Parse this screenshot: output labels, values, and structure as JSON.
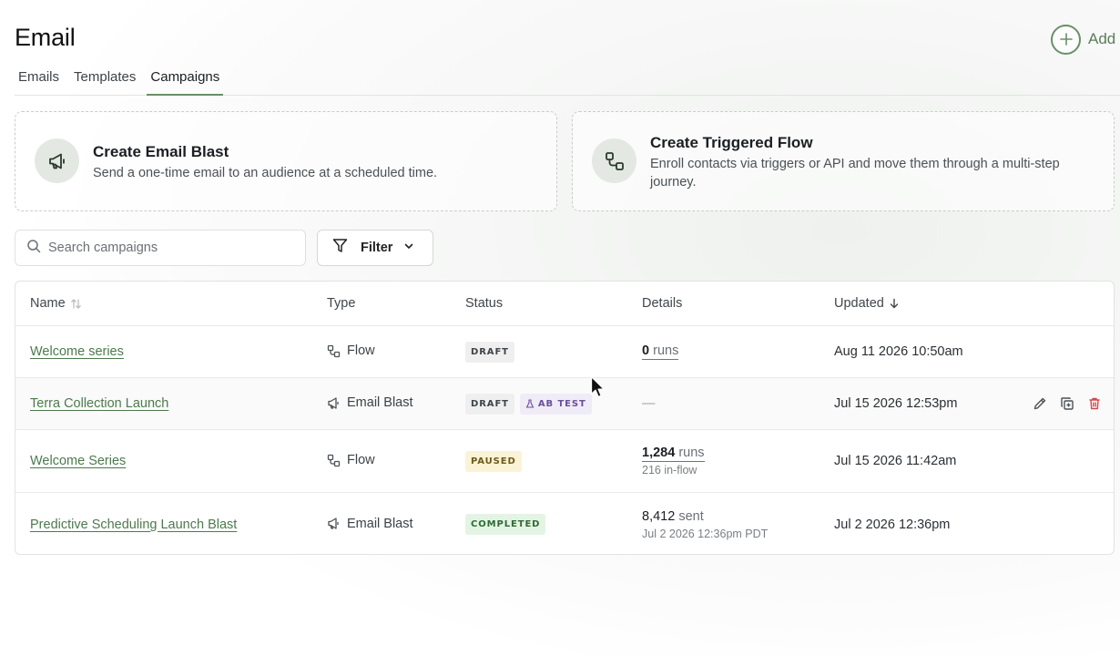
{
  "page": {
    "title": "Email",
    "add_label": "Add"
  },
  "tabs": [
    {
      "label": "Emails",
      "active": false
    },
    {
      "label": "Templates",
      "active": false
    },
    {
      "label": "Campaigns",
      "active": true
    }
  ],
  "cards": [
    {
      "icon": "megaphone-icon",
      "title": "Create Email Blast",
      "description": "Send a one-time email to an audience at a scheduled time."
    },
    {
      "icon": "flow-icon",
      "title": "Create Triggered Flow",
      "description": "Enroll contacts via triggers or API and move them through a multi-step journey."
    }
  ],
  "search": {
    "placeholder": "Search campaigns",
    "value": ""
  },
  "filter": {
    "label": "Filter"
  },
  "table": {
    "headers": {
      "name": "Name",
      "type": "Type",
      "status": "Status",
      "details": "Details",
      "updated": "Updated"
    },
    "rows": [
      {
        "name": "Welcome series",
        "type": "Flow",
        "status": "DRAFT",
        "details_main": "0",
        "details_unit": "runs",
        "details_sub": "",
        "updated": "Aug 11 2026 10:50am"
      },
      {
        "name": "Terra Collection Launch",
        "type": "Email Blast",
        "status": "DRAFT",
        "extra_badge": "AB TEST",
        "details_main": "—",
        "updated": "Jul 15 2026 12:53pm"
      },
      {
        "name": "Welcome Series",
        "type": "Flow",
        "status": "PAUSED",
        "details_main": "1,284",
        "details_unit": "runs",
        "details_sub": "216 in-flow",
        "updated": "Jul 15 2026 11:42am"
      },
      {
        "name": "Predictive Scheduling Launch Blast",
        "type": "Email Blast",
        "status": "COMPLETED",
        "details_main": "8,412",
        "details_unit": "sent",
        "details_sub": "Jul 2 2026 12:36pm PDT",
        "updated": "Jul 2 2026 12:36pm"
      }
    ]
  },
  "colors": {
    "accent": "#6a8f69",
    "link": "#4d7a4c",
    "delete": "#d14a4a"
  }
}
